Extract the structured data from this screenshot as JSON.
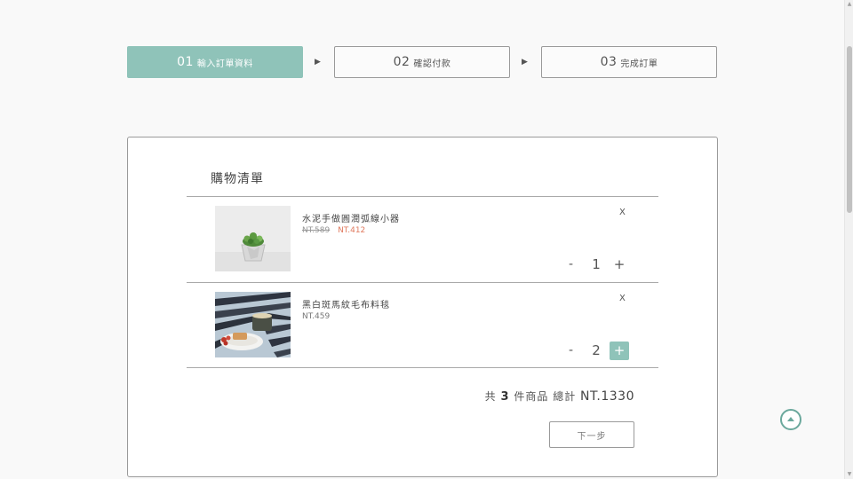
{
  "steps": [
    {
      "num": "01",
      "label": "輸入訂單資料",
      "active": true
    },
    {
      "num": "02",
      "label": "確認付款",
      "active": false
    },
    {
      "num": "03",
      "label": "完成訂單",
      "active": false
    }
  ],
  "step_arrow": "▶",
  "cart": {
    "title": "購物清單",
    "items": [
      {
        "name": "水泥手做圓潤弧線小器",
        "price_old": "NT.589",
        "price_new": "NT.412",
        "quantity": "1",
        "remove": "X",
        "minus": "-",
        "plus": "+"
      },
      {
        "name": "黑白斑馬紋毛布料毯",
        "price": "NT.459",
        "quantity": "2",
        "remove": "X",
        "minus": "-",
        "plus": "+"
      }
    ],
    "summary": {
      "prefix": "共",
      "count": "3",
      "middle": "件商品 總計",
      "total": "NT.1330"
    },
    "next_label": "下一步"
  },
  "colors": {
    "accent": "#8fc3b9",
    "sale": "#e07a5f",
    "back_to_top": "#6aa89c"
  },
  "icons": {
    "back_to_top": "chevron-up-circle-icon"
  }
}
